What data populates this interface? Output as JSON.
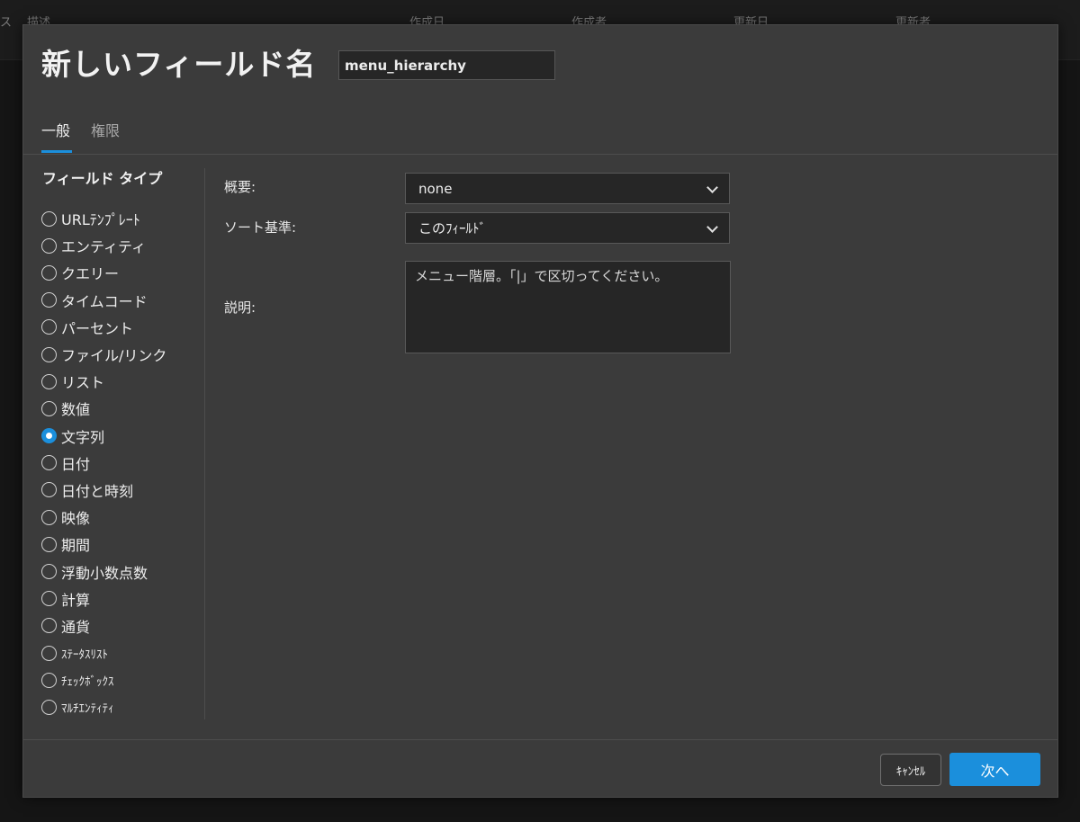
{
  "background": {
    "fragments": [
      "ス",
      "描述",
      "作成日",
      "作成者",
      "更新日",
      "更新者"
    ]
  },
  "dialog": {
    "title": "新しいフィールド名",
    "name_value": "menu_hierarchy",
    "tabs": [
      {
        "label": "一般",
        "active": true
      },
      {
        "label": "権限",
        "active": false
      }
    ]
  },
  "field_types": {
    "title": "フィールド タイプ",
    "selected": "文字列",
    "items": [
      {
        "label": "URLﾃﾝﾌﾟﾚｰﾄ"
      },
      {
        "label": "エンティティ"
      },
      {
        "label": "クエリー"
      },
      {
        "label": "タイムコード"
      },
      {
        "label": "パーセント"
      },
      {
        "label": "ファイル/リンク"
      },
      {
        "label": "リスト"
      },
      {
        "label": "数値"
      },
      {
        "label": "文字列"
      },
      {
        "label": "日付"
      },
      {
        "label": "日付と時刻"
      },
      {
        "label": "映像"
      },
      {
        "label": "期間"
      },
      {
        "label": "浮動小数点数"
      },
      {
        "label": "計算"
      },
      {
        "label": "通貨"
      },
      {
        "label": "ｽﾃｰﾀｽﾘｽﾄ"
      },
      {
        "label": "ﾁｪｯｸﾎﾞｯｸｽ"
      },
      {
        "label": "ﾏﾙﾁｴﾝﾃｨﾃｨ"
      }
    ]
  },
  "form": {
    "summary_label": "概要:",
    "summary_value": "none",
    "sort_label": "ソート基準:",
    "sort_value": "このﾌｨｰﾙﾄﾞ",
    "description_label": "説明:",
    "description_value": "メニュー階層。「|」で区切ってください。"
  },
  "footer": {
    "cancel_label": "ｷｬﾝｾﾙ",
    "next_label": "次へ"
  },
  "colors": {
    "accent": "#1b8fdc",
    "modal_bg": "#3b3b3b",
    "input_bg": "#262626"
  }
}
